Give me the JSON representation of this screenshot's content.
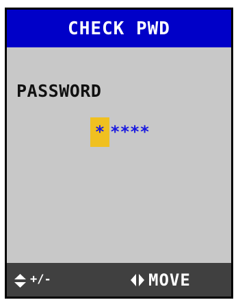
{
  "header": {
    "title": "CHECK PWD"
  },
  "main": {
    "label": "PASSWORD",
    "password": {
      "cursor_char": "*",
      "rest": "****"
    }
  },
  "footer": {
    "updown_icon": "up-down-arrows-icon",
    "updown_hint": "+/-",
    "leftright_icon": "left-right-arrows-icon",
    "move_hint": "MOVE"
  },
  "colors": {
    "header_bg": "#0000c8",
    "body_bg": "#c8c8c8",
    "footer_bg": "#404040",
    "cursor_bg": "#f0c020",
    "password_text": "#1818e0"
  }
}
